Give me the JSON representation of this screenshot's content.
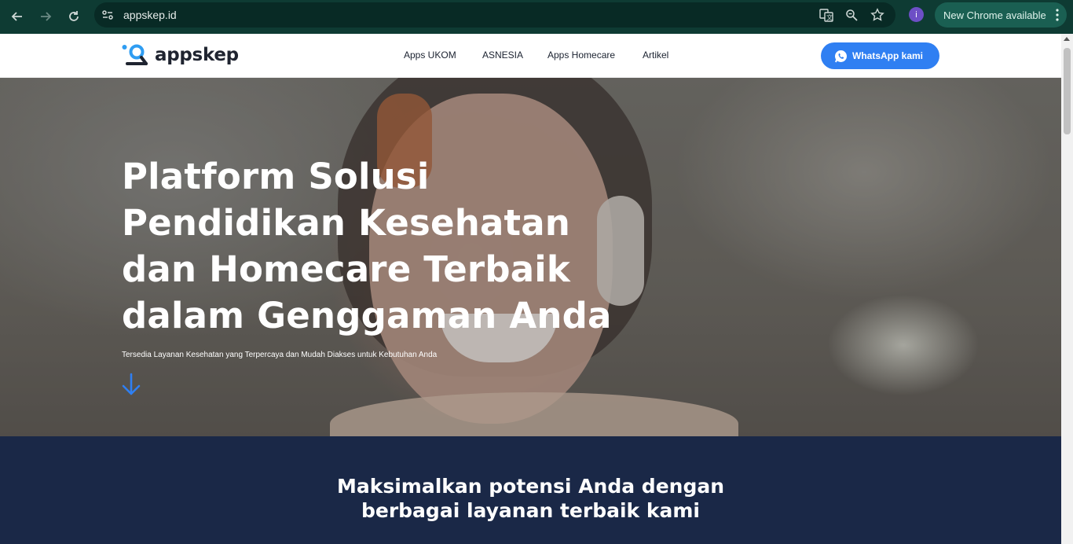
{
  "browser": {
    "url": "appskep.id",
    "profile_initial": "i",
    "update_label": "New Chrome available"
  },
  "site": {
    "logo_text": "appskep",
    "nav": [
      "Apps UKOM",
      "ASNESIA",
      "Apps Homecare",
      "Artikel"
    ],
    "cta_label": "WhatsApp kami"
  },
  "hero": {
    "title_lines": [
      "Platform Solusi",
      "Pendidikan Kesehatan",
      "dan Homecare Terbaik",
      "dalam Genggaman Anda"
    ],
    "subtitle": "Tersedia Layanan Kesehatan yang Terpercaya dan Mudah Diakses untuk Kebutuhan Anda"
  },
  "services": {
    "heading_lines": [
      "Maksimalkan potensi Anda dengan",
      "berbagai layanan terbaik kami"
    ]
  },
  "colors": {
    "chrome_bar": "#0e3b33",
    "brand_blue": "#2f7ff2",
    "navy_section": "#1a2847"
  }
}
